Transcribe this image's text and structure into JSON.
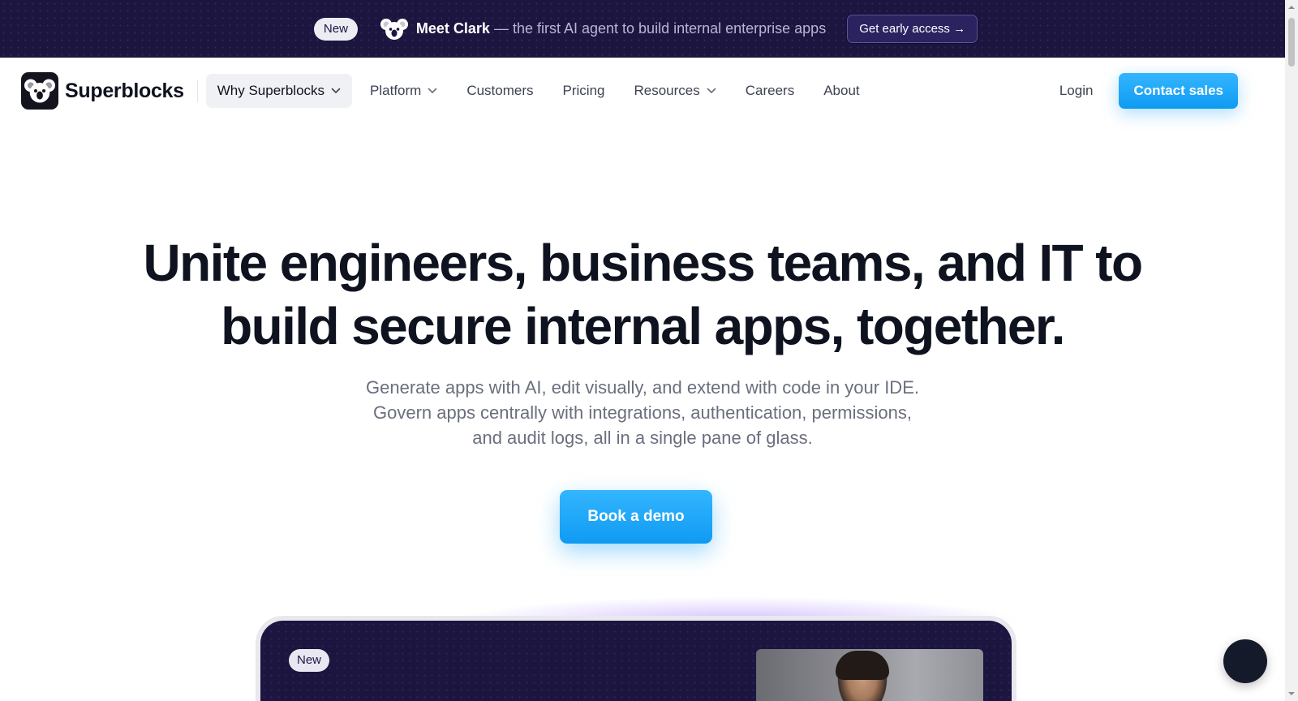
{
  "announcement": {
    "badge": "New",
    "icon": "koala-icon",
    "headline": "Meet Clark",
    "text": " — the first AI agent to build internal enterprise apps",
    "cta": "Get early access →"
  },
  "nav": {
    "brand": "Superblocks",
    "items": [
      {
        "label": "Why Superblocks",
        "dropdown": true,
        "active": true
      },
      {
        "label": "Platform",
        "dropdown": true,
        "active": false
      },
      {
        "label": "Customers",
        "dropdown": false,
        "active": false
      },
      {
        "label": "Pricing",
        "dropdown": false,
        "active": false
      },
      {
        "label": "Resources",
        "dropdown": true,
        "active": false
      },
      {
        "label": "Careers",
        "dropdown": false,
        "active": false
      },
      {
        "label": "About",
        "dropdown": false,
        "active": false
      }
    ],
    "login": "Login",
    "contact": "Contact sales"
  },
  "hero": {
    "title_line1": "Unite engineers, business teams, and IT to",
    "title_line2": "build secure internal apps, together.",
    "sub_line1": "Generate apps with AI, edit visually, and extend with code in your IDE.",
    "sub_line2": "Govern apps centrally with integrations, authentication, permissions,",
    "sub_line3": "and audit logs, all in a single pane of glass.",
    "cta": "Book a demo"
  },
  "preview": {
    "badge": "New"
  },
  "colors": {
    "accent": "#1aa6f7",
    "banner_bg": "#1b1540",
    "heading": "#0f1320"
  }
}
